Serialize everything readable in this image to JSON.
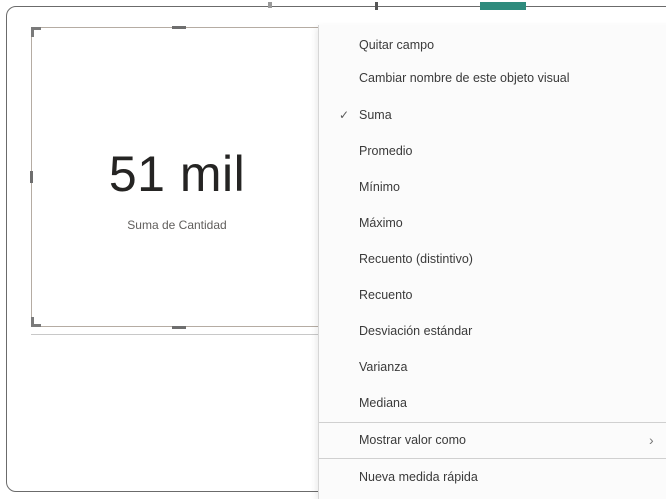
{
  "visual": {
    "value": "51 mil",
    "caption": "Suma de Cantidad"
  },
  "context_menu": {
    "items": [
      {
        "label": "Quitar campo",
        "checked": false
      },
      {
        "label": "Cambiar nombre de este objeto visual",
        "checked": false
      },
      {
        "label": "Suma",
        "checked": true
      },
      {
        "label": "Promedio",
        "checked": false
      },
      {
        "label": "Mínimo",
        "checked": false
      },
      {
        "label": "Máximo",
        "checked": false
      },
      {
        "label": "Recuento (distintivo)",
        "checked": false
      },
      {
        "label": "Recuento",
        "checked": false
      },
      {
        "label": "Desviación estándar",
        "checked": false
      },
      {
        "label": "Varianza",
        "checked": false
      },
      {
        "label": "Mediana",
        "checked": false
      },
      {
        "label": "Mostrar valor como",
        "checked": false
      },
      {
        "label": "Nueva medida rápida",
        "checked": false
      }
    ],
    "check_glyph": "✓",
    "submenu_glyph": "›"
  },
  "colors": {
    "accent": "#2e8b7d",
    "text": "#252423",
    "caption": "#605e5c",
    "menu_bg": "#fbfbfb"
  }
}
